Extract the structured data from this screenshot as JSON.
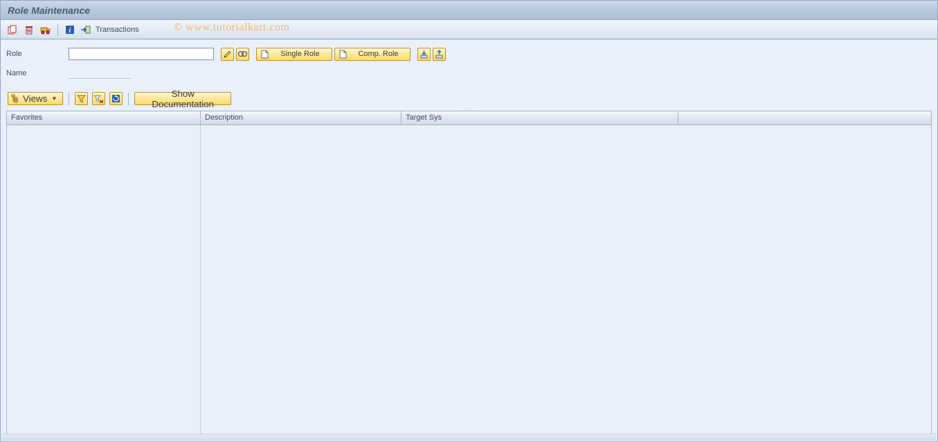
{
  "title": "Role Maintenance",
  "watermark": "© www.tutorialkart.com",
  "toolbar": {
    "transactions_label": "Transactions"
  },
  "form": {
    "role_label": "Role",
    "role_value": "",
    "name_label": "Name",
    "single_role_label": "Single Role",
    "comp_role_label": "Comp. Role"
  },
  "views_bar": {
    "views_label": "Views",
    "show_doc_label": "Show Documentation"
  },
  "grid": {
    "columns": {
      "favorites": "Favorites",
      "description": "Description",
      "target_sys": "Target Sys"
    },
    "rows": []
  }
}
